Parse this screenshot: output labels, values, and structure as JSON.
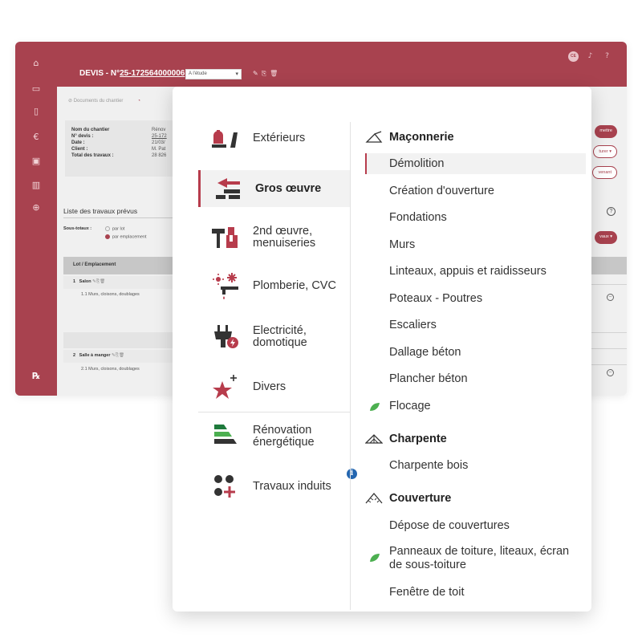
{
  "app": {
    "title_prefix": "DEVIS - N°",
    "quote_number": "25-172564000006",
    "status_value": "A l'étude",
    "user_initials": "CE",
    "docs_link": "Documents du chantier"
  },
  "sidebar": {
    "icons": [
      "home-icon",
      "folder-icon",
      "document-icon",
      "euro-icon",
      "contact-icon",
      "library-icon",
      "globe-icon",
      "logo-icon"
    ]
  },
  "info": {
    "rows": [
      {
        "key": "Nom du chantier",
        "value": "Rénov"
      },
      {
        "key": "N° devis :",
        "value": "25-172"
      },
      {
        "key": "Date :",
        "value": "21/03/"
      },
      {
        "key": "Client :",
        "value": "M. Pat"
      },
      {
        "key": "Total des travaux :",
        "value": "28 826"
      }
    ]
  },
  "list": {
    "title": "Liste des travaux prévus",
    "subtotals_label": "Sous-totaux :",
    "option_lot": "par lot",
    "option_location": "par emplacement",
    "header": "Lot / Emplacement",
    "lot1_num": "1",
    "lot1_name": "Salon",
    "item1": "1.1  Murs, cloisons, doublages",
    "lot2_num": "2",
    "lot2_name": "Salle à manger",
    "item2": "2.1  Murs, cloisons, doublages"
  },
  "right_buttons": {
    "top": "mettre",
    "second": "turer ▾",
    "third": "venant",
    "works": "vaux ▾"
  },
  "menu": {
    "categories": [
      {
        "label": "Extérieurs",
        "icon": "exterior-icon",
        "active": false
      },
      {
        "label": "Gros œuvre",
        "icon": "structural-icon",
        "active": true
      },
      {
        "label_line1": "2nd œuvre,",
        "label_line2": "menuiseries",
        "icon": "tools-icon",
        "active": false
      },
      {
        "label": "Plomberie, CVC",
        "icon": "plumbing-icon",
        "active": false
      },
      {
        "label_line1": "Electricité,",
        "label_line2": "domotique",
        "icon": "electric-plug-icon",
        "active": false
      },
      {
        "label": "Divers",
        "icon": "star-icon",
        "active": false
      },
      {
        "label_line1": "Rénovation",
        "label_line2": "énergétique",
        "icon": "energy-icon",
        "active": false
      },
      {
        "label": "Travaux induits",
        "icon": "induced-works-icon",
        "active": false
      }
    ],
    "sections": {
      "maconnerie": {
        "title": "Maçonnerie",
        "items": [
          "Démolition",
          "Création d'ouverture",
          "Fondations",
          "Murs",
          "Linteaux, appuis et raidisseurs",
          "Poteaux - Poutres",
          "Escaliers",
          "Dallage béton",
          "Plancher béton",
          "Flocage"
        ]
      },
      "charpente": {
        "title": "Charpente",
        "items": [
          "Charpente bois"
        ]
      },
      "couverture": {
        "title": "Couverture",
        "items": [
          "Dépose de couvertures",
          "Panneaux de toiture, liteaux, écran",
          "de sous-toiture",
          "Fenêtre de toit"
        ]
      }
    }
  },
  "colors": {
    "brand": "#a8424f",
    "accent": "#b73c4c",
    "leaf": "#4caf50",
    "info": "#2466b0"
  }
}
